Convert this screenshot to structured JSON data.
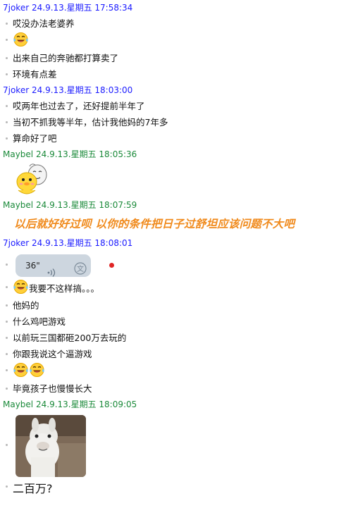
{
  "messages": [
    {
      "type": "header",
      "sender": "7joker",
      "time": "24.9.13.星期五 17:58:34",
      "color": "blue"
    },
    {
      "type": "text",
      "text": "哎没办法老婆养"
    },
    {
      "type": "emoji",
      "emoji": "laugh-cry-emoji"
    },
    {
      "type": "text",
      "text": "出来自己的奔驰都打算卖了"
    },
    {
      "type": "text",
      "text": "环境有点差"
    },
    {
      "type": "header",
      "sender": "7joker",
      "time": "24.9.13.星期五 18:03:00",
      "color": "blue"
    },
    {
      "type": "text",
      "text": "哎两年也过去了，还好提前半年了"
    },
    {
      "type": "text",
      "text": "当初不抓我等半年，估计我他妈的7年多"
    },
    {
      "type": "text",
      "text": "算命好了吧"
    },
    {
      "type": "header",
      "sender": "Maybel",
      "time": "24.9.13.星期五 18:05:36",
      "color": "green"
    },
    {
      "type": "sticker",
      "emoji": "duck-sticker"
    },
    {
      "type": "header",
      "sender": "Maybel",
      "time": "24.9.13.星期五 18:07:59",
      "color": "green"
    },
    {
      "type": "bigtext",
      "text": "以后就好好过呗 以你的条件把日子过舒坦应该问题不大吧"
    },
    {
      "type": "header",
      "sender": "7joker",
      "time": "24.9.13.星期五 18:08:01",
      "color": "blue"
    },
    {
      "type": "voice",
      "duration": "36\"",
      "unread": true
    },
    {
      "type": "emoji_text",
      "emoji": "laugh-cry-emoji",
      "text": "我要不这样搞。。。"
    },
    {
      "type": "text",
      "text": "他妈的"
    },
    {
      "type": "text",
      "text": "什么鸡吧游戏"
    },
    {
      "type": "text",
      "text": "以前玩三国都砸200万去玩的"
    },
    {
      "type": "text",
      "text": "你跟我说这个逼游戏"
    },
    {
      "type": "emoji2",
      "emoji": "laugh-cry-emoji"
    },
    {
      "type": "text",
      "text": "毕竟孩子也慢慢长大"
    },
    {
      "type": "header",
      "sender": "Maybel",
      "time": "24.9.13.星期五 18:09:05",
      "color": "green"
    },
    {
      "type": "photo",
      "emoji": "alpaca-photo"
    },
    {
      "type": "finaltext",
      "text": "二百万?"
    }
  ],
  "colors": {
    "blue": "#1a1aff",
    "green": "#1b8a3a",
    "orange": "#f08a1c",
    "unread": "#e02525",
    "bubble": "#cdd6df"
  }
}
